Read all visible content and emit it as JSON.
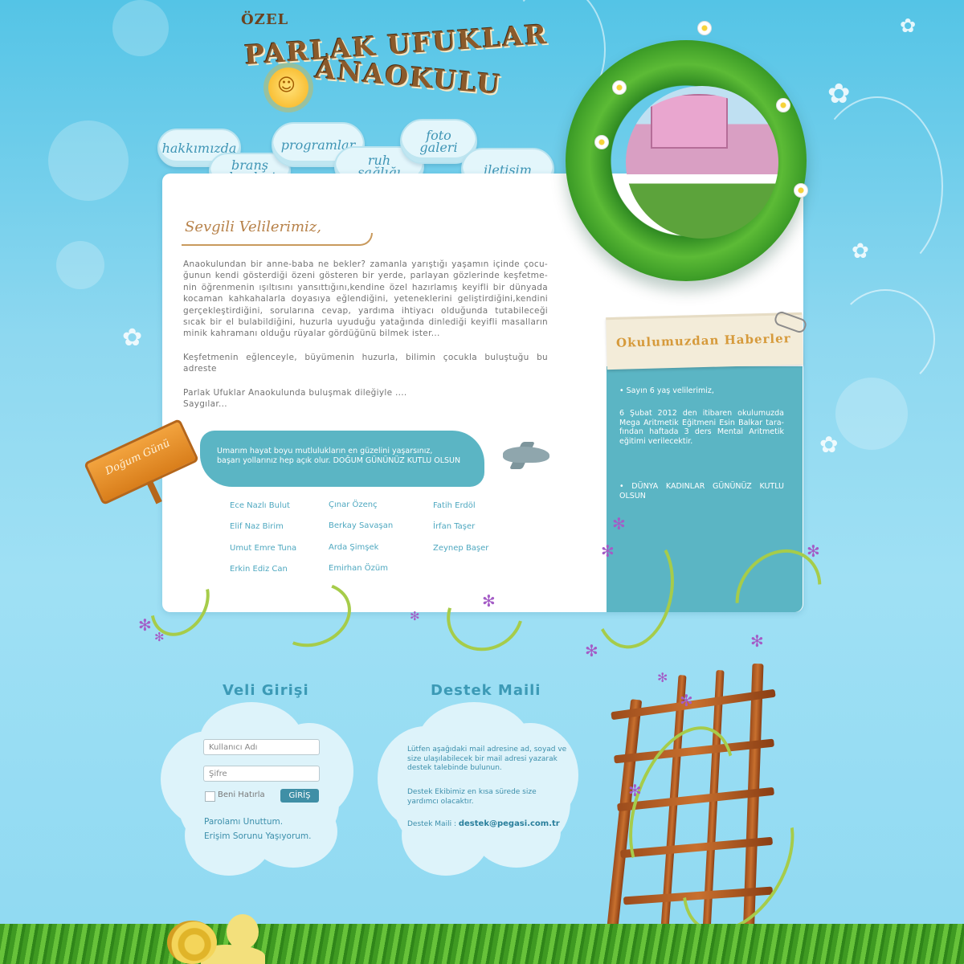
{
  "logo": {
    "prefix": "ÖZEL",
    "line1": "PARLAK UFUKLAR",
    "line2": "ANAOKULU"
  },
  "nav": [
    {
      "label": "hakkımızda"
    },
    {
      "label": "branş dersleri"
    },
    {
      "label": "programlar"
    },
    {
      "label": "ruh sağlığı"
    },
    {
      "label": "foto galeri"
    },
    {
      "label": "iletişim"
    }
  ],
  "welcome": {
    "title": "Sevgili Velilerimiz,",
    "paragraphs": [
      "Anaokulundan bir anne-baba ne bekler? zamanla yarıştığı yaşamın içinde çocu-ğunun kendi gösterdiği özeni gösteren bir yerde, parlayan gözlerinde keşfetme-nin öğrenmenin ışıltısını yansıttığını,kendine özel hazırlamış keyifli bir dünyada kocaman kahkahalarla doyasıya eğlendiğini, yeteneklerini geliştirdiğini,kendini gerçekleştirdiğini, sorularına cevap, yardıma ihtiyacı olduğunda tutabileceği sıcak bir el bulabildiğini, huzurla uyuduğu yatağında dinlediği keyifli masalların minik kahramanı olduğu rüyalar gördüğünü bilmek ister...",
      "Keşfetmenin eğlenceyle, büyümenin huzurla, bilimin çocukla buluştuğu bu adreste",
      "Parlak Ufuklar Anaokulunda buluşmak dileğiyle ....",
      "Saygılar..."
    ]
  },
  "news": {
    "title": "Okulumuzdan Haberler",
    "items": [
      "• Sayın 6 yaş velilerimiz,",
      "6 Şubat 2012 den itibaren okulumuzda Mega Aritmetik Eğitmeni Esin Balkar tara-fından haftada 3 ders Mental Aritmetik eğitimi verilecektir.",
      "• DÜNYA KADINLAR GÜNÜNÜZ KUTLU OLSUN"
    ]
  },
  "birthday": {
    "sign": "Doğum Günü",
    "message_line1": "Umarım hayat boyu mutlulukların en güzelini yaşarsınız,",
    "message_line2": "başarı yollarınız hep açık olur. DOĞUM GÜNÜNÜZ KUTLU OLSUN",
    "names_col1": [
      "Ece Nazlı Bulut",
      "Elif Naz Birim",
      "Umut Emre Tuna",
      "Erkin Ediz Can"
    ],
    "names_col2": [
      "Çınar Özenç",
      "Berkay Savaşan",
      "Arda Şimşek",
      "Emirhan Özüm"
    ],
    "names_col3": [
      "Fatih Erdöl",
      "İrfan Taşer",
      "Zeynep Başer"
    ]
  },
  "login": {
    "title": "Veli Girişi",
    "username_placeholder": "Kullanıcı Adı",
    "password_placeholder": "Şifre",
    "remember_label": "Beni Hatırla",
    "submit_label": "GİRİŞ",
    "forgot_link": "Parolamı Unuttum.",
    "access_link": "Erişim Sorunu Yaşıyorum."
  },
  "support": {
    "title": "Destek Maili",
    "text1": "Lütfen aşağıdaki mail adresine ad, soyad ve size ulaşılabilecek bir mail adresi yazarak destek talebinde bulunun.",
    "text2": "Destek Ekibimiz en kısa sürede size yardımcı olacaktır.",
    "mail_label": "Destek Maili :",
    "mail_address": "destek@pegasi.com.tr"
  },
  "colors": {
    "sky": "#8fd9f2",
    "teal": "#5bb5c4",
    "brown": "#8a5a2b",
    "text_blue": "#3c8fab"
  }
}
